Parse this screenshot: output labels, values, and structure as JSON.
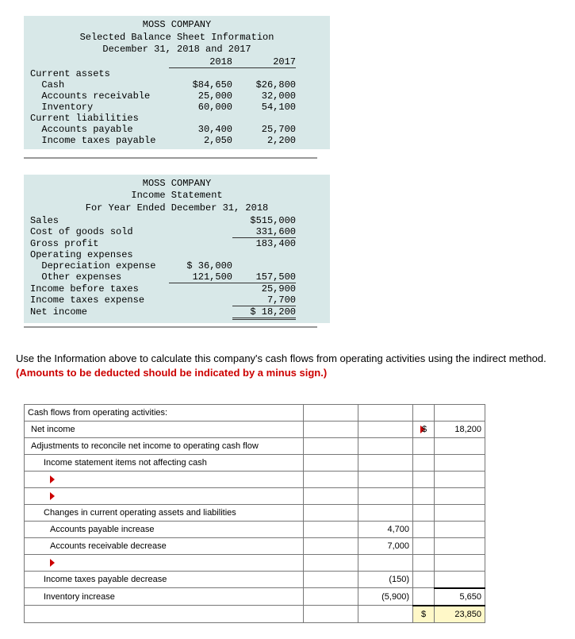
{
  "balance_sheet": {
    "company": "MOSS COMPANY",
    "title": "Selected Balance Sheet Information",
    "period": "December 31, 2018 and 2017",
    "year1": "2018",
    "year2": "2017",
    "sections": {
      "current_assets_hdr": "Current assets",
      "cash_lbl": "  Cash",
      "cash_y1": "$84,650",
      "cash_y2": "$26,800",
      "ar_lbl": "  Accounts receivable",
      "ar_y1": "25,000",
      "ar_y2": "32,000",
      "inv_lbl": "  Inventory",
      "inv_y1": "60,000",
      "inv_y2": "54,100",
      "current_liab_hdr": "Current liabilities",
      "ap_lbl": "  Accounts payable",
      "ap_y1": "30,400",
      "ap_y2": "25,700",
      "itp_lbl": "  Income taxes payable",
      "itp_y1": "2,050",
      "itp_y2": "2,200"
    }
  },
  "income_statement": {
    "company": "MOSS COMPANY",
    "title": "Income Statement",
    "period": "For Year Ended December 31, 2018",
    "sales_lbl": "Sales",
    "sales_val": "$515,000",
    "cogs_lbl": "Cost of goods sold",
    "cogs_val": "331,600",
    "gp_lbl": "Gross profit",
    "gp_val": "183,400",
    "opex_hdr": "Operating expenses",
    "dep_lbl": "  Depreciation expense",
    "dep_val": "$ 36,000",
    "oth_lbl": "  Other expenses",
    "oth_val": "121,500",
    "opex_total": "157,500",
    "ibt_lbl": "Income before taxes",
    "ibt_val": "25,900",
    "ite_lbl": "Income taxes expense",
    "ite_val": "7,700",
    "ni_lbl": "Net income",
    "ni_val": "$ 18,200"
  },
  "instructions": {
    "line1": "Use the Information above to calculate this company's cash flows from operating activities using the indirect method. ",
    "line2": "(Amounts to be deducted should be indicated by a minus sign.)"
  },
  "cashflow": {
    "hdr": "Cash flows from operating activities:",
    "net_income_lbl": "Net income",
    "net_income_sym": "$",
    "net_income_val": "18,200",
    "adj_hdr": "Adjustments to reconcile net income to operating cash flow",
    "nsitems_hdr": "Income statement items not affecting cash",
    "changes_hdr": "Changes in current operating assets and liabilities",
    "ap_inc_lbl": "Accounts payable increase",
    "ap_inc_val": "4,700",
    "ar_dec_lbl": "Accounts receivable decrease",
    "ar_dec_val": "7,000",
    "itp_dec_lbl": "Income taxes payable decrease",
    "itp_dec_val": "(150)",
    "inv_inc_lbl": "Inventory increase",
    "inv_inc_val": "(5,900)",
    "subtotal_val": "5,650",
    "total_sym": "$",
    "total_val": "23,850"
  }
}
